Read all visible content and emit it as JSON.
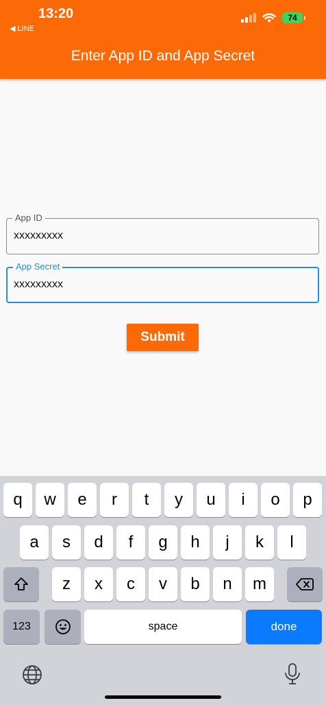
{
  "status_bar": {
    "time": "13:20",
    "back_label": "◀ LINE",
    "battery": "74"
  },
  "appbar": {
    "title": "Enter App ID and App Secret"
  },
  "form": {
    "app_id": {
      "label": "App ID",
      "value": "xxxxxxxxx"
    },
    "app_secret": {
      "label": "App Secret",
      "value": "xxxxxxxxx"
    },
    "submit_label": "Submit"
  },
  "keyboard": {
    "row1": [
      "q",
      "w",
      "e",
      "r",
      "t",
      "y",
      "u",
      "i",
      "o",
      "p"
    ],
    "row2": [
      "a",
      "s",
      "d",
      "f",
      "g",
      "h",
      "j",
      "k",
      "l"
    ],
    "row3": [
      "z",
      "x",
      "c",
      "v",
      "b",
      "n",
      "m"
    ],
    "numbers_label": "123",
    "space_label": "space",
    "done_label": "done"
  }
}
